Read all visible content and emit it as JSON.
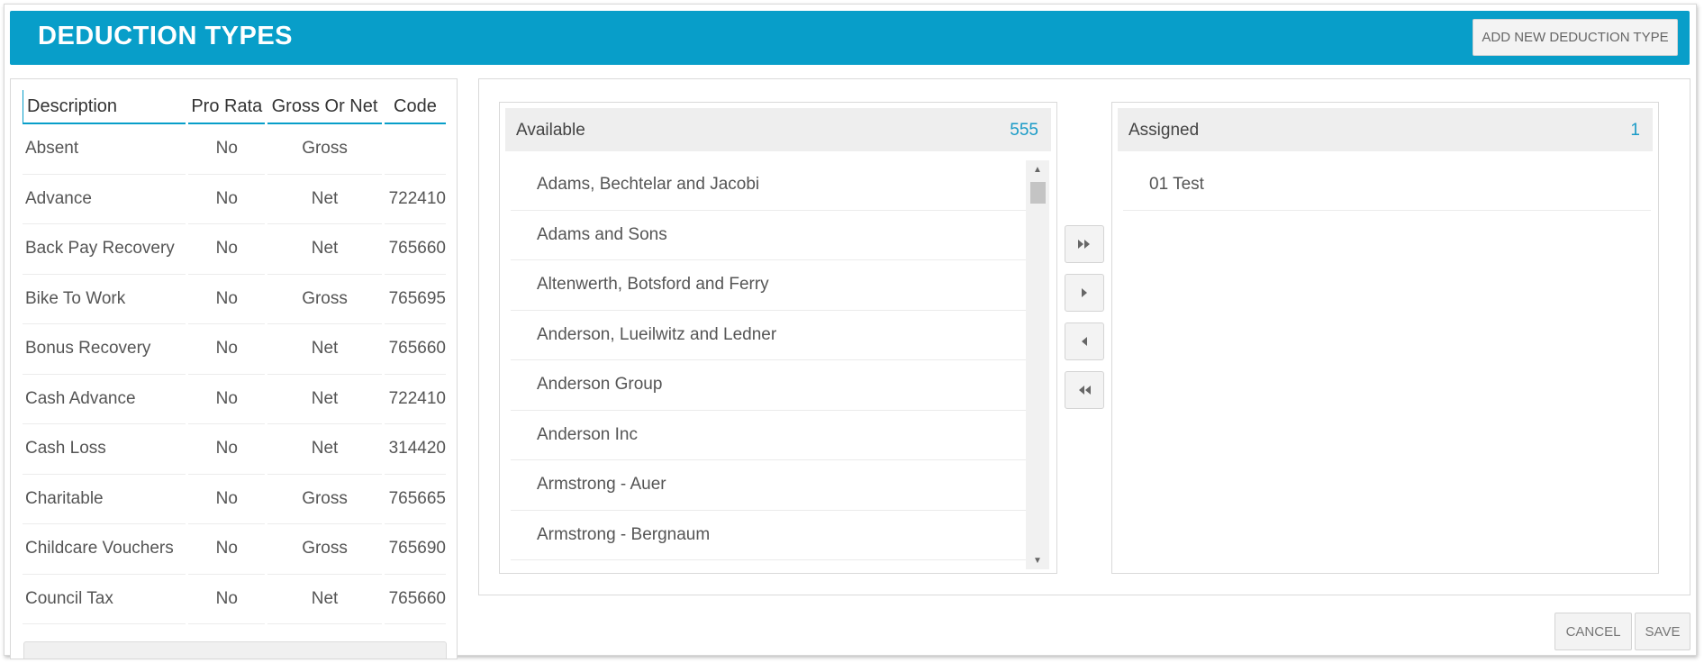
{
  "header": {
    "title": "DEDUCTION TYPES",
    "add_button": "ADD NEW DEDUCTION TYPE"
  },
  "deduction_table": {
    "columns": [
      "Description",
      "Pro Rata",
      "Gross Or Net",
      "Code"
    ],
    "rows": [
      [
        "Absent",
        "No",
        "Gross",
        ""
      ],
      [
        "Advance",
        "No",
        "Net",
        "722410"
      ],
      [
        "Back Pay Recovery",
        "No",
        "Net",
        "765660"
      ],
      [
        "Bike To Work",
        "No",
        "Gross",
        "765695"
      ],
      [
        "Bonus Recovery",
        "No",
        "Net",
        "765660"
      ],
      [
        "Cash Advance",
        "No",
        "Net",
        "722410"
      ],
      [
        "Cash Loss",
        "No",
        "Net",
        "314420"
      ],
      [
        "Charitable",
        "No",
        "Gross",
        "765665"
      ],
      [
        "Childcare Vouchers",
        "No",
        "Gross",
        "765690"
      ],
      [
        "Council Tax",
        "No",
        "Net",
        "765660"
      ]
    ]
  },
  "available": {
    "title": "Available",
    "count": "555",
    "items": [
      "Adams, Bechtelar and Jacobi",
      "Adams and Sons",
      "Altenwerth, Botsford and Ferry",
      "Anderson, Lueilwitz and Ledner",
      "Anderson Group",
      "Anderson Inc",
      "Armstrong - Auer",
      "Armstrong - Bergnaum"
    ]
  },
  "assigned": {
    "title": "Assigned",
    "count": "1",
    "items": [
      "01 Test"
    ]
  },
  "move_buttons": [
    {
      "icon": "double-chevron-right-icon",
      "name": "move-all-right-button"
    },
    {
      "icon": "chevron-right-icon",
      "name": "move-right-button"
    },
    {
      "icon": "chevron-left-icon",
      "name": "move-left-button"
    },
    {
      "icon": "double-chevron-left-icon",
      "name": "move-all-left-button"
    }
  ],
  "footer": {
    "cancel": "CANCEL",
    "save": "SAVE"
  },
  "colors": {
    "accent": "#089ec9",
    "count_text": "#1a9bc7"
  }
}
